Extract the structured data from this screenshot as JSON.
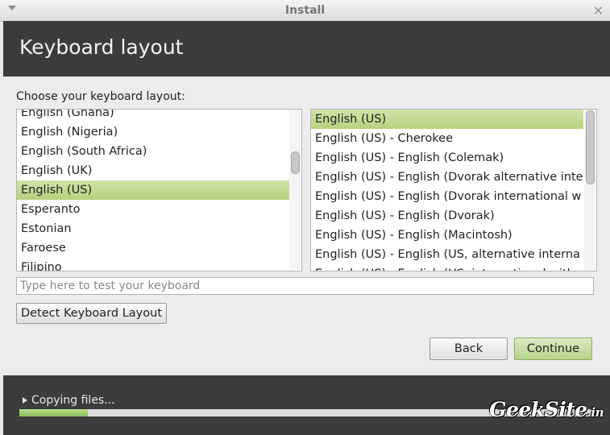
{
  "window": {
    "title": "Install"
  },
  "header": {
    "title": "Keyboard layout"
  },
  "prompt": "Choose your keyboard layout:",
  "left_list": {
    "items": [
      "English (Ghana)",
      "English (Nigeria)",
      "English (South Africa)",
      "English (UK)",
      "English (US)",
      "Esperanto",
      "Estonian",
      "Faroese",
      "Filipino"
    ],
    "selected": "English (US)"
  },
  "right_list": {
    "items": [
      "English (US)",
      "English (US) - Cherokee",
      "English (US) - English (Colemak)",
      "English (US) - English (Dvorak alternative inte",
      "English (US) - English (Dvorak international w",
      "English (US) - English (Dvorak)",
      "English (US) - English (Macintosh)",
      "English (US) - English (US, alternative interna",
      "English (US) - English (US, international with"
    ],
    "selected": "English (US)"
  },
  "test_input": {
    "placeholder": "Type here to test your keyboard",
    "value": ""
  },
  "buttons": {
    "detect": "Detect Keyboard Layout",
    "back": "Back",
    "continue": "Continue"
  },
  "footer": {
    "status": "Copying files...",
    "progress": 0.12
  },
  "watermark": {
    "main": "GeekSite",
    "suffix": ".in"
  },
  "colors": {
    "header_bg": "#3c3c3c",
    "selection": "#b5d27e",
    "progress": "#8dbd58"
  }
}
